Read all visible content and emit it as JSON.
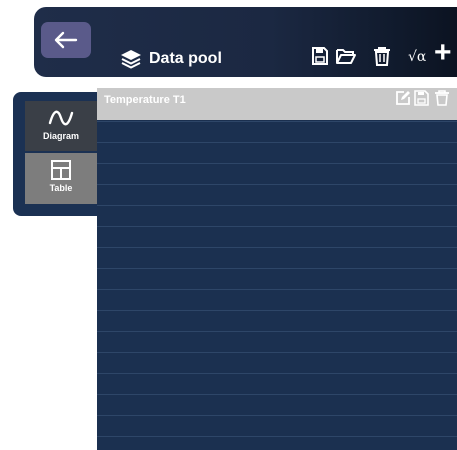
{
  "header": {
    "title": "Data pool",
    "formula_label": "√α",
    "add_label": "+"
  },
  "sidebar": {
    "items": [
      {
        "label": "Diagram",
        "icon": "sine-wave-icon"
      },
      {
        "label": "Table",
        "icon": "table-icon"
      }
    ]
  },
  "series": {
    "title": "Temperature T1"
  },
  "colors": {
    "topbar": "#1f2d49",
    "back_button": "#5a5a8a",
    "content_bg": "#1b3050",
    "series_header": "#c9c9c9",
    "diagram_button": "#3a3f47",
    "table_button": "#7d7d7d"
  }
}
